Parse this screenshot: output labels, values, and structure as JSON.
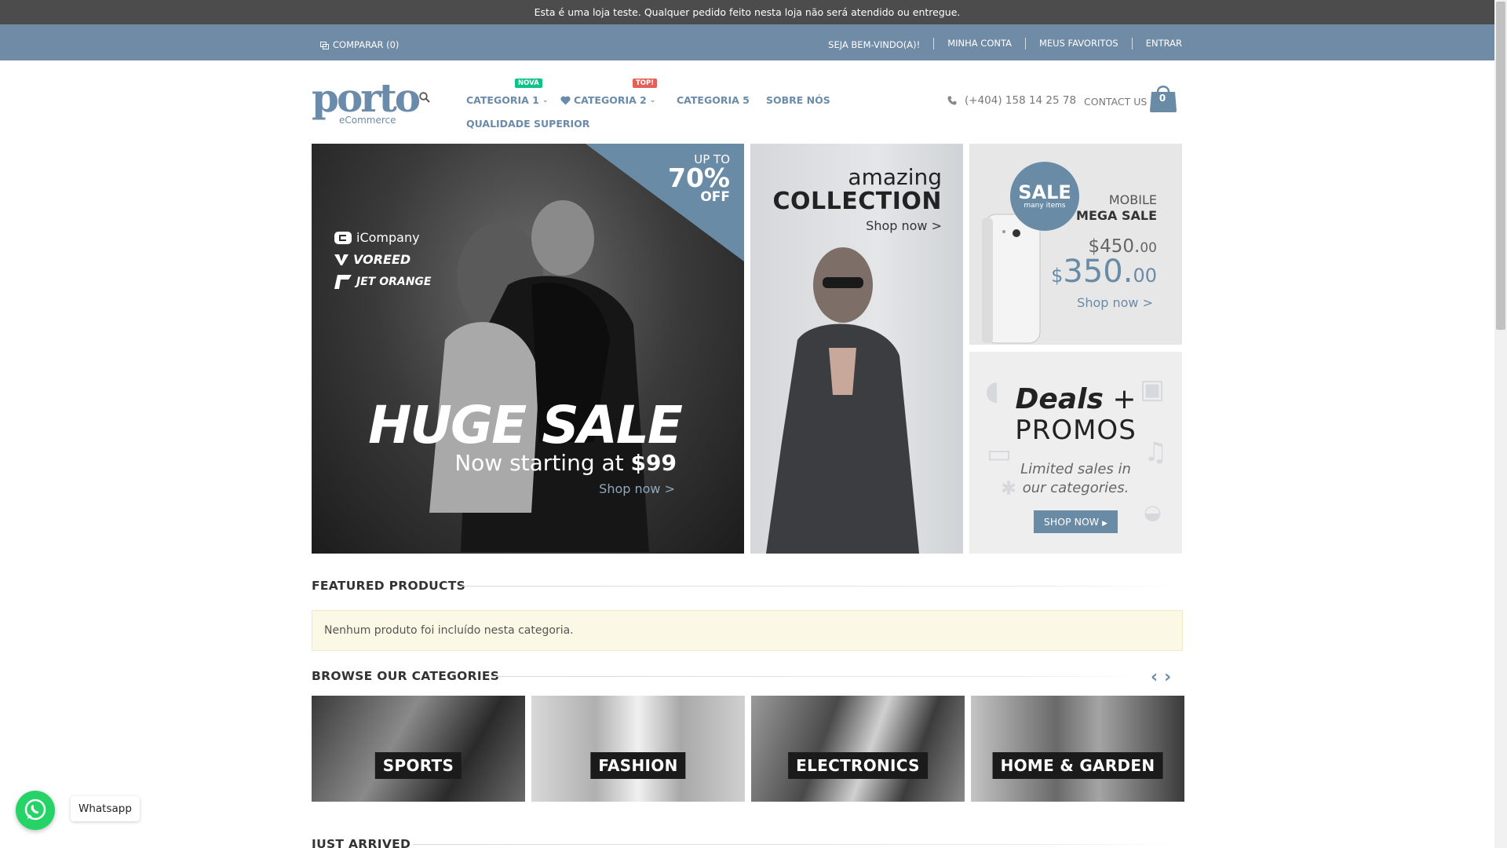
{
  "notice": "Esta é uma loja teste. Qualquer pedido feito nesta loja não será atendido ou entregue.",
  "topbar": {
    "compare": "COMPARAR (0)",
    "welcome": "SEJA BEM-VINDO(A)!",
    "account": "MINHA CONTA",
    "favorites": "MEUS FAVORITOS",
    "login": "ENTRAR"
  },
  "logo": {
    "word": "porto",
    "sub": "eCommerce"
  },
  "nav": {
    "items": [
      {
        "label": "CATEGORIA 1",
        "badge": "NOVA"
      },
      {
        "label": "CATEGORIA 2",
        "badge": "TOP!"
      },
      {
        "label": "CATEGORIA 5"
      },
      {
        "label": "SOBRE NÓS"
      },
      {
        "label": "QUALIDADE SUPERIOR"
      }
    ]
  },
  "phone": "(+404) 158 14 25 78",
  "contact": "CONTACT US",
  "cart_count": "0",
  "banner_main": {
    "upto": "UP TO",
    "pct": "70%",
    "off": "OFF",
    "brands": [
      "iCompany",
      "VOREED",
      "JET ORANGE"
    ],
    "headline": "HUGE SALE",
    "starting": "Now starting at",
    "price": "$99",
    "cta": "Shop now >"
  },
  "banner_collection": {
    "t1": "amazing",
    "t2": "COLLECTION",
    "cta": "Shop now >"
  },
  "banner_mobile": {
    "sale": "SALE",
    "sale_sub": "many items",
    "t1": "MOBILE",
    "t2": "MEGA SALE",
    "old_price_main": "$450.",
    "old_price_cents": "00",
    "new_price_sign": "$",
    "new_price_main": "350.",
    "new_price_cents": "00",
    "cta": "Shop now >"
  },
  "banner_deals": {
    "t1_bold": "Deals",
    "t1_rest": " +",
    "t2": "PROMOS",
    "t3_line1": "Limited sales in",
    "t3_line2": "our categories.",
    "cta": "SHOP NOW"
  },
  "featured": {
    "title": "FEATURED PRODUCTS",
    "empty": "Nenhum produto foi incluído nesta categoria."
  },
  "browse": {
    "title": "BROWSE OUR CATEGORIES",
    "categories": [
      "SPORTS",
      "FASHION",
      "ELECTRONICS",
      "HOME & GARDEN"
    ]
  },
  "just_arrived": "JUST ARRIVED",
  "whatsapp": "Whatsapp",
  "colors": {
    "accent": "#6a8ba6",
    "topbar": "#6f8ba6",
    "notice_bg": "#4c4c4c",
    "whatsapp": "#25d366"
  }
}
